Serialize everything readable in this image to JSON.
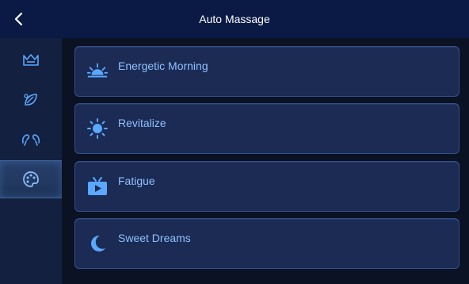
{
  "header": {
    "title": "Auto Massage",
    "back_icon": "chevron-left-icon"
  },
  "sidebar": {
    "items": [
      {
        "icon": "crown-icon",
        "active": false
      },
      {
        "icon": "leaf-icon",
        "active": false
      },
      {
        "icon": "hands-icon",
        "active": false
      },
      {
        "icon": "palette-icon",
        "active": true
      }
    ]
  },
  "programs": [
    {
      "label": "Energetic Morning",
      "icon": "sunrise-icon"
    },
    {
      "label": "Revitalize",
      "icon": "sun-icon"
    },
    {
      "label": "Fatigue",
      "icon": "tv-icon"
    },
    {
      "label": "Sweet Dreams",
      "icon": "moon-icon"
    }
  ],
  "colors": {
    "accent": "#5aa8ff",
    "card_text": "#8fc0ff",
    "topbar": "#0a1a44",
    "sidebar": "#13203f",
    "card": "#1b2b54"
  }
}
